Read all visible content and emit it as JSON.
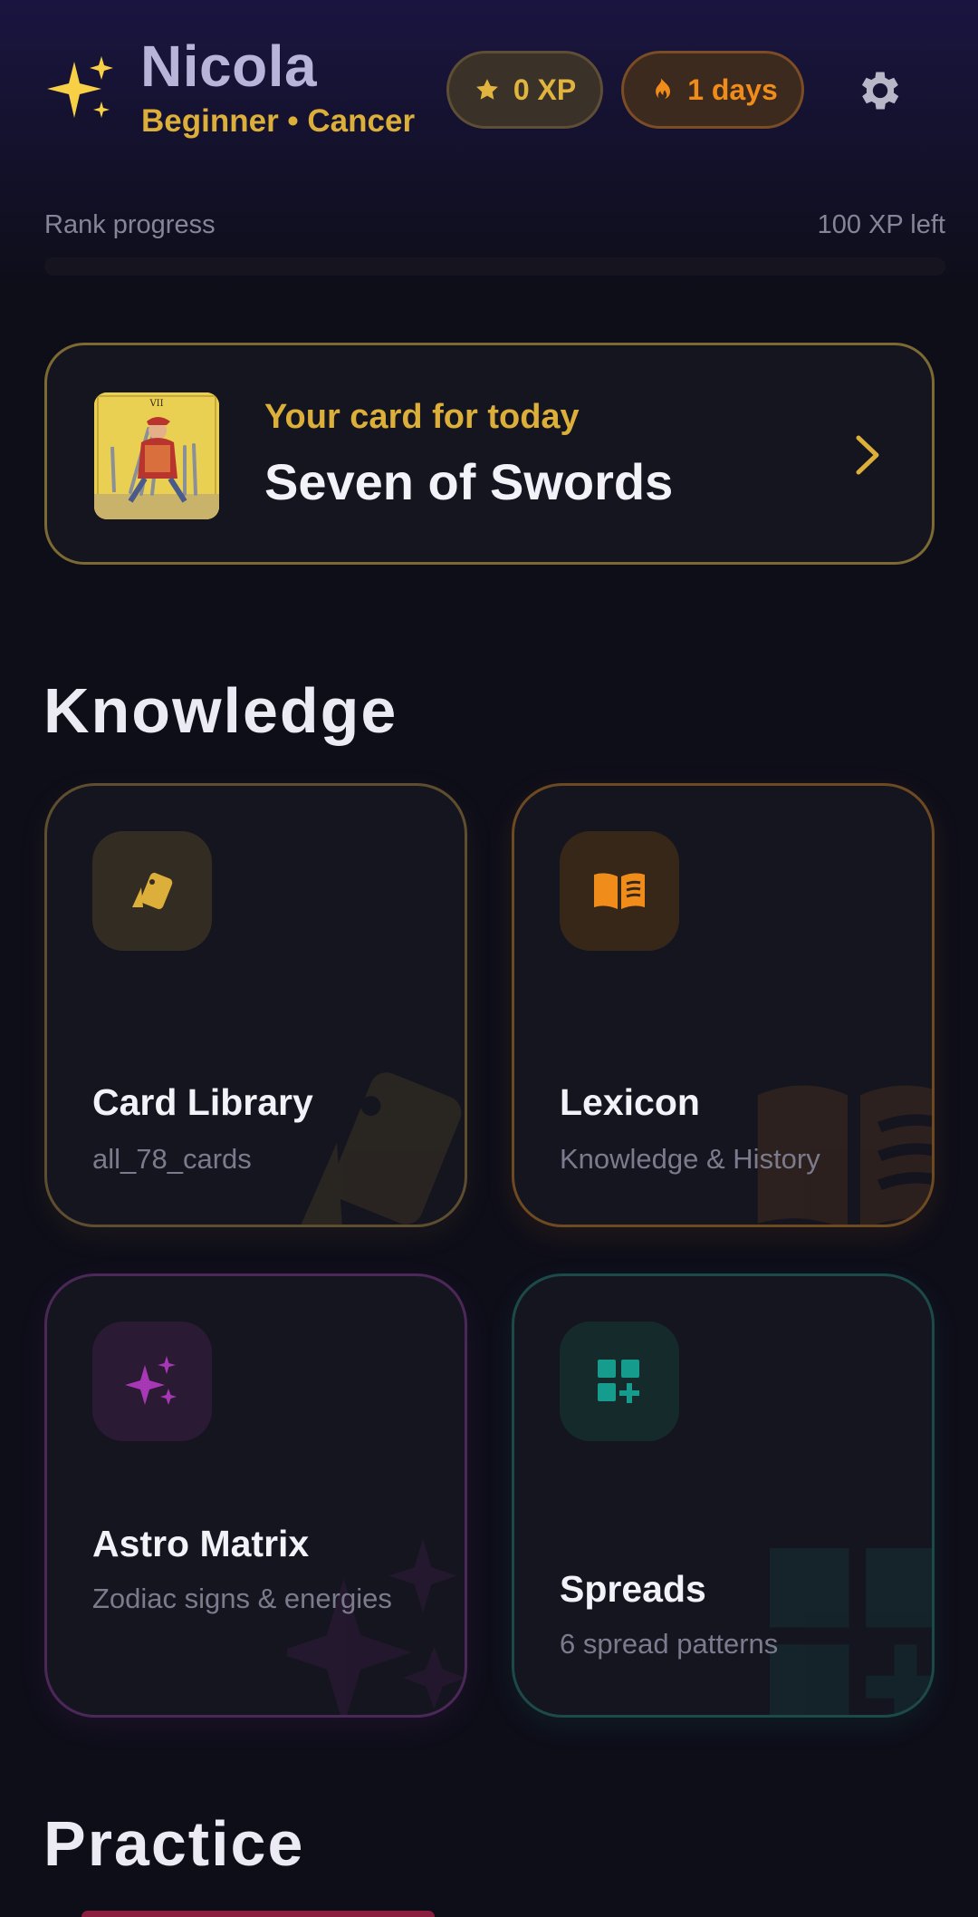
{
  "header": {
    "name": "Nicola",
    "subtitle": "Beginner • Cancer",
    "xp_label": "0 XP",
    "streak_label": "1 days",
    "icons": {
      "sparkle": "sparkles-emoji-icon",
      "xp": "star-icon",
      "streak": "flame-icon",
      "settings": "gear-icon"
    }
  },
  "rank": {
    "label": "Rank progress",
    "remaining": "100 XP left",
    "progress_fraction": 0
  },
  "daily": {
    "kicker": "Your card for today",
    "card_name": "Seven of Swords",
    "card_numeral": "VII"
  },
  "sections": {
    "knowledge": "Knowledge",
    "practice": "Practice"
  },
  "tiles": [
    {
      "title": "Card Library",
      "subtitle": "all_78_cards",
      "icon": "cards-icon",
      "accent": "#dcae3a"
    },
    {
      "title": "Lexicon",
      "subtitle": "Knowledge & History",
      "icon": "book-icon",
      "accent": "#f08c1a"
    },
    {
      "title": "Astro Matrix",
      "subtitle": "Zodiac signs & energies",
      "icon": "sparkle-icon",
      "accent": "#a637b5"
    },
    {
      "title": "Spreads",
      "subtitle": "6 spread patterns",
      "icon": "grid-plus-icon",
      "accent": "#159c8c"
    }
  ],
  "colors": {
    "gold": "#dcae3a",
    "orange": "#f08c1a",
    "purple": "#a637b5",
    "teal": "#159c8c",
    "background": "#0e0e19"
  }
}
